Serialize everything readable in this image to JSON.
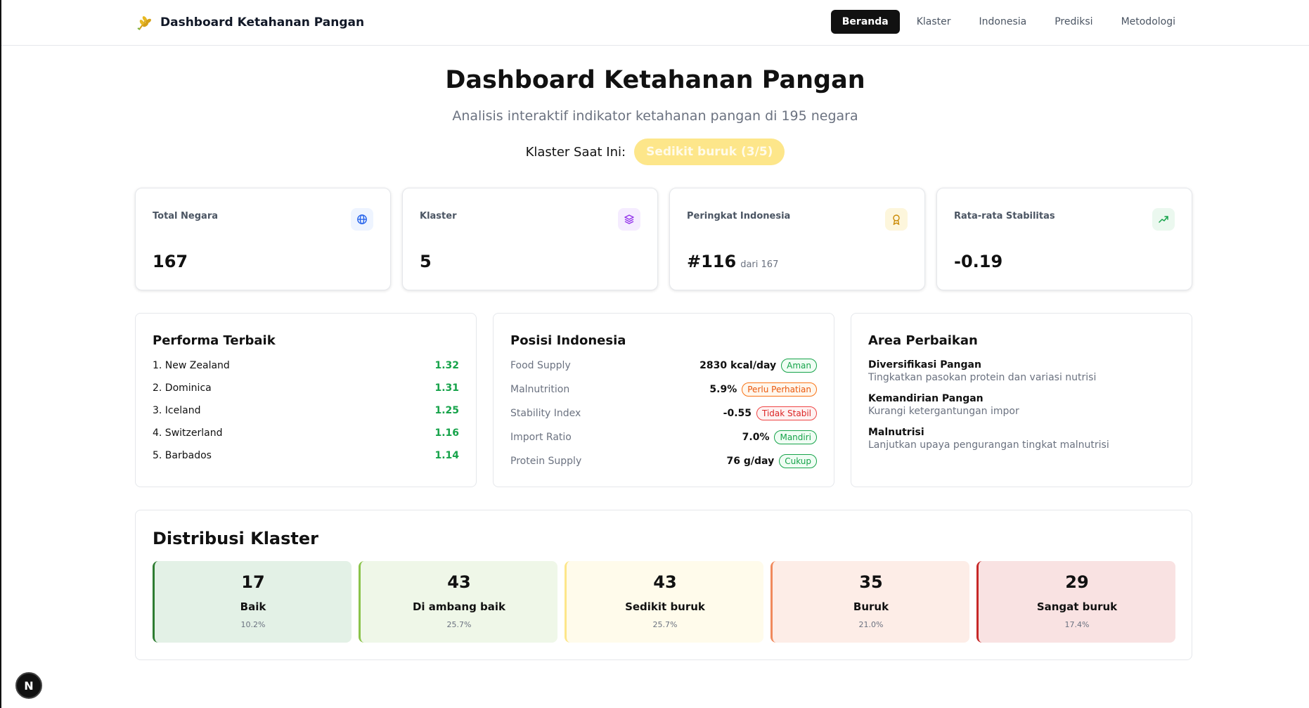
{
  "nav": {
    "brand": "Dashboard Ketahanan Pangan",
    "items": [
      {
        "label": "Beranda",
        "active": true
      },
      {
        "label": "Klaster",
        "active": false
      },
      {
        "label": "Indonesia",
        "active": false
      },
      {
        "label": "Prediksi",
        "active": false
      },
      {
        "label": "Metodologi",
        "active": false
      }
    ]
  },
  "hero": {
    "title": "Dashboard Ketahanan Pangan",
    "subtitle": "Analisis interaktif indikator ketahanan pangan di 195 negara",
    "cluster_label": "Klaster Saat Ini:",
    "cluster_badge": "Sedikit buruk (3/5)"
  },
  "stats": [
    {
      "label": "Total Negara",
      "value": "167",
      "sub": "",
      "icon": "globe-icon",
      "color": "#2563eb"
    },
    {
      "label": "Klaster",
      "value": "5",
      "sub": "",
      "icon": "layers-icon",
      "color": "#9333ea"
    },
    {
      "label": "Peringkat Indonesia",
      "value": "#116",
      "sub": "dari 167",
      "icon": "award-icon",
      "color": "#ca8a04"
    },
    {
      "label": "Rata-rata Stabilitas",
      "value": "-0.19",
      "sub": "",
      "icon": "trending-up-icon",
      "color": "#16a34a"
    }
  ],
  "best": {
    "title": "Performa Terbaik",
    "rows": [
      {
        "name": "1. New Zealand",
        "value": "1.32"
      },
      {
        "name": "2. Dominica",
        "value": "1.31"
      },
      {
        "name": "3. Iceland",
        "value": "1.25"
      },
      {
        "name": "4. Switzerland",
        "value": "1.16"
      },
      {
        "name": "5. Barbados",
        "value": "1.14"
      }
    ]
  },
  "position": {
    "title": "Posisi Indonesia",
    "rows": [
      {
        "label": "Food Supply",
        "value": "2830 kcal/day",
        "badge": "Aman",
        "tone": "green"
      },
      {
        "label": "Malnutrition",
        "value": "5.9%",
        "badge": "Perlu Perhatian",
        "tone": "orange"
      },
      {
        "label": "Stability Index",
        "value": "-0.55",
        "badge": "Tidak Stabil",
        "tone": "red"
      },
      {
        "label": "Import Ratio",
        "value": "7.0%",
        "badge": "Mandiri",
        "tone": "green"
      },
      {
        "label": "Protein Supply",
        "value": "76 g/day",
        "badge": "Cukup",
        "tone": "green"
      }
    ]
  },
  "improve": {
    "title": "Area Perbaikan",
    "items": [
      {
        "title": "Diversifikasi Pangan",
        "desc": "Tingkatkan pasokan protein dan variasi nutrisi"
      },
      {
        "title": "Kemandirian Pangan",
        "desc": "Kurangi ketergantungan impor"
      },
      {
        "title": "Malnutrisi",
        "desc": "Lanjutkan upaya pengurangan tingkat malnutrisi"
      }
    ]
  },
  "distribution": {
    "title": "Distribusi Klaster",
    "boxes": [
      {
        "count": "17",
        "name": "Baik",
        "pct": "10.2%",
        "bg": "#e3f1e6",
        "border": "#2e7d32"
      },
      {
        "count": "43",
        "name": "Di ambang baik",
        "pct": "25.7%",
        "bg": "#eff7e8",
        "border": "#8bc34a"
      },
      {
        "count": "43",
        "name": "Sedikit buruk",
        "pct": "25.7%",
        "bg": "#fffbeb",
        "border": "#fde68a"
      },
      {
        "count": "35",
        "name": "Buruk",
        "pct": "21.0%",
        "bg": "#fdede7",
        "border": "#f08a5d"
      },
      {
        "count": "29",
        "name": "Sangat buruk",
        "pct": "17.4%",
        "bg": "#f9e2e2",
        "border": "#c62828"
      }
    ]
  },
  "devtools_badge": "N"
}
